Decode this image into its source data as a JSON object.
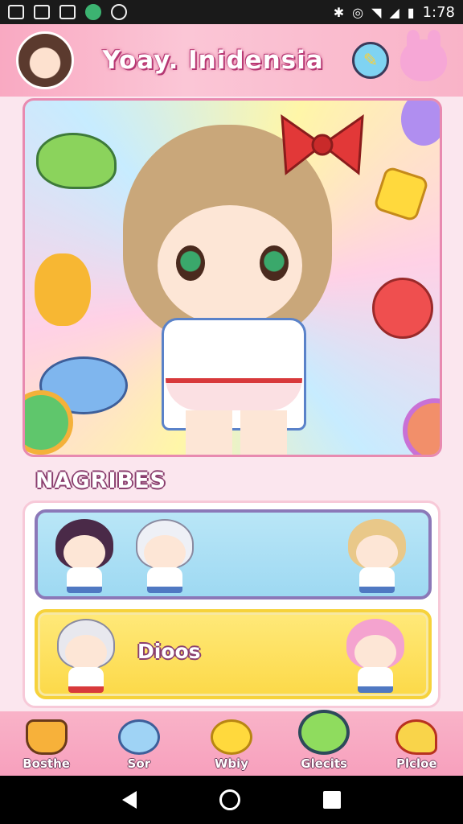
{
  "status_bar": {
    "time": "1:78",
    "left_icons": [
      "image-icon",
      "news-icon",
      "gallery-icon",
      "spotify-icon",
      "pinwheel-icon"
    ],
    "right_icons": [
      "bluetooth-icon",
      "alarm-icon",
      "wifi-icon",
      "signal-icon",
      "battery-icon"
    ]
  },
  "header": {
    "title": "Yoay. Inidensia",
    "edit_icon": "pencil-icon",
    "mascot_icon": "bunny-icon"
  },
  "section": {
    "title": "NAGRIBES"
  },
  "rows": [
    {
      "label": ""
    },
    {
      "label": "Dioos"
    }
  ],
  "bottom_nav": [
    {
      "label": "Bosthe",
      "icon": "cupcake-icon"
    },
    {
      "label": "Sor",
      "icon": "cloud-icon"
    },
    {
      "label": "Wbiy",
      "icon": "sun-blob-icon"
    },
    {
      "label": "Glecits",
      "icon": "frog-icon",
      "active": true
    },
    {
      "label": "Plcloe",
      "icon": "heart-icon"
    }
  ],
  "colors": {
    "accent_pink": "#f9a9c2",
    "row_blue": "#9ed9f2",
    "row_yellow": "#fcd948",
    "outline_purple": "#8b78b8"
  }
}
